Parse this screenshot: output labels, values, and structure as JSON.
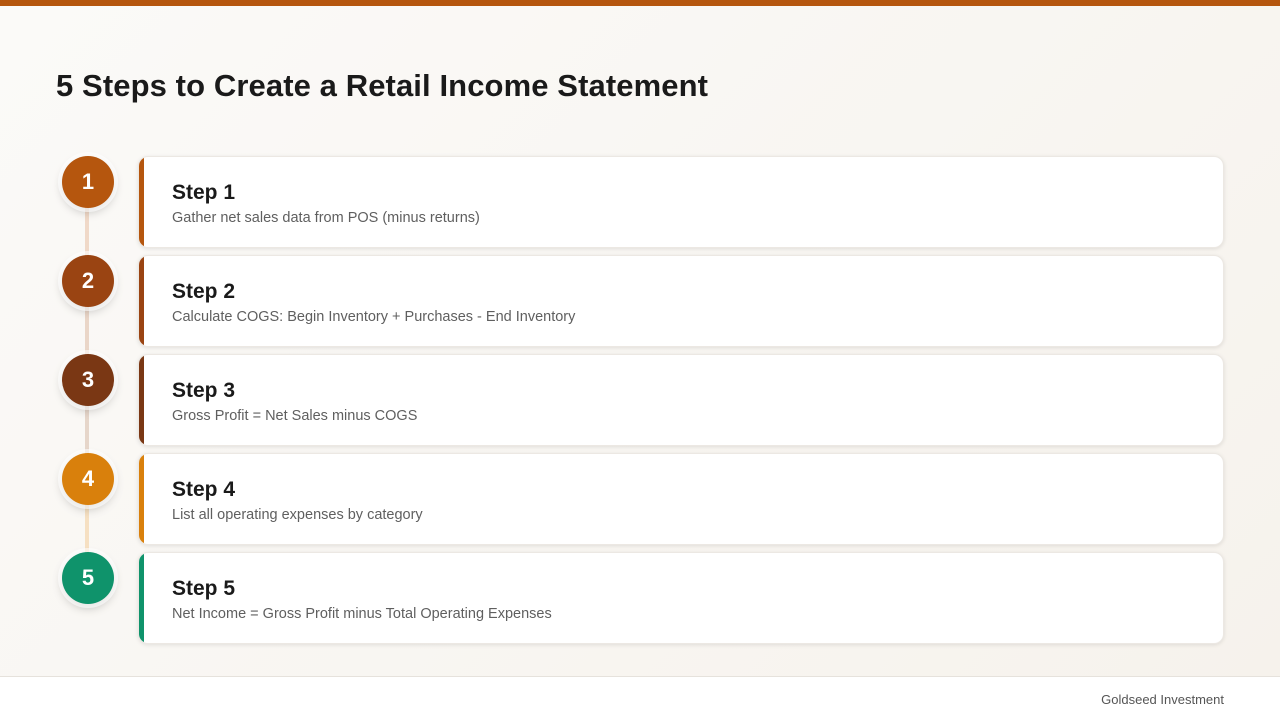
{
  "colors": {
    "top_bar": "#b5560e",
    "step1": "#b5560e",
    "step2": "#9a4412",
    "step3": "#7a3714",
    "step4": "#d9800c",
    "step5": "#0f936b"
  },
  "title": "5 Steps to Create a Retail Income Statement",
  "steps": [
    {
      "number": "1",
      "label": "Step 1",
      "description": "Gather net sales data from POS (minus returns)"
    },
    {
      "number": "2",
      "label": "Step 2",
      "description": "Calculate COGS: Begin Inventory + Purchases - End Inventory"
    },
    {
      "number": "3",
      "label": "Step 3",
      "description": "Gross Profit = Net Sales minus COGS"
    },
    {
      "number": "4",
      "label": "Step 4",
      "description": "List all operating expenses by category"
    },
    {
      "number": "5",
      "label": "Step 5",
      "description": "Net Income = Gross Profit minus Total Operating Expenses"
    }
  ],
  "footer": {
    "brand": "Goldseed Investment"
  }
}
